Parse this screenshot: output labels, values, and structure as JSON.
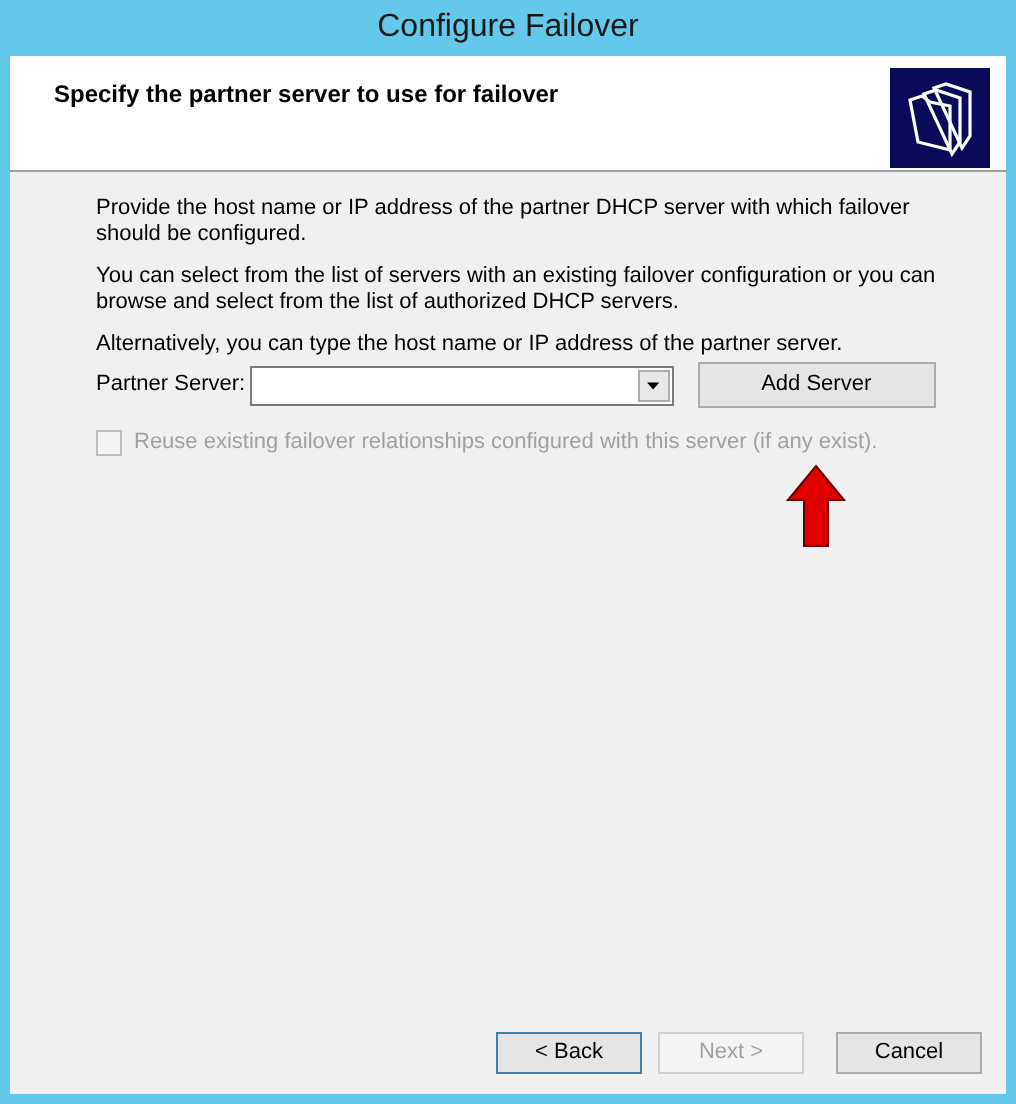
{
  "window": {
    "title": "Configure Failover"
  },
  "header": {
    "title": "Specify the partner server to use for failover"
  },
  "paragraphs": [
    "Provide the host name or IP address of the partner DHCP server with which failover should be configured.",
    "You can select from the list of servers with an existing failover configuration or you can browse and select from the list of authorized DHCP servers.",
    "Alternatively, you can type the host name or IP address of the partner server."
  ],
  "partner_server": {
    "label": "Partner Server:",
    "button": "Add Server"
  },
  "reuse_checkbox": {
    "label": "Reuse existing failover relationships configured with this server (if any exist).",
    "checked": false,
    "disabled": true
  },
  "buttons": [
    {
      "label": "< Back",
      "disabled": false,
      "default": true
    },
    {
      "label": "Next >",
      "disabled": true,
      "default": false
    },
    {
      "label": "Cancel",
      "disabled": false,
      "default": false
    }
  ]
}
